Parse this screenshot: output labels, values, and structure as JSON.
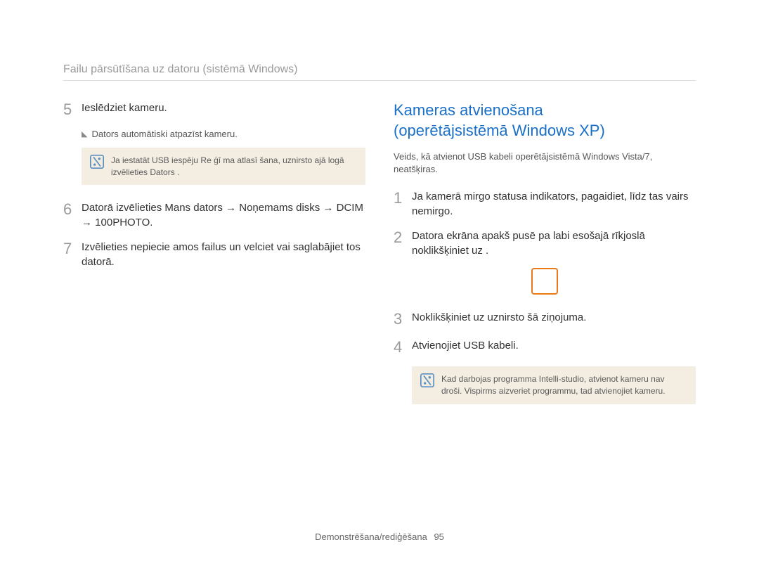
{
  "breadcrumb": "Failu pārsūtīšana uz datoru (sistēmā Windows)",
  "left": {
    "step5": {
      "num": "5",
      "text": "Ieslēdziet kameru.",
      "sub": "Dators automātiski atpazīst kameru.",
      "note": "Ja iestatāt USB iespēju Re ģī ma atlasī šana, uznirsto ajā logā izvēlieties Dators ."
    },
    "step6": {
      "num": "6",
      "text": "Datorā izvēlieties Mans dators → Noņemams disks  → DCIM → 100PHOTO."
    },
    "step7": {
      "num": "7",
      "text": "Izvēlieties nepiecie amos failus un velciet vai saglabājiet tos datorā."
    }
  },
  "right": {
    "title_line1": "Kameras atvienošana",
    "title_line2": "(operētājsistēmā Windows XP)",
    "lead": "Veids, kā atvienot USB kabeli operētājsistēmā Windows Vista/7, neatšķiras.",
    "step1": {
      "num": "1",
      "text": "Ja kamerā mirgo statusa indikators, pagaidiet, līdz tas vairs nemirgo."
    },
    "step2": {
      "num": "2",
      "text": "Datora ekrāna apakš pusē pa labi esošajā rīkjoslā noklikšķiniet uz     ."
    },
    "step3": {
      "num": "3",
      "text": "Noklikšķiniet uz uznirsto šā ziņojuma."
    },
    "step4": {
      "num": "4",
      "text": "Atvienojiet USB kabeli."
    },
    "note": "Kad darbojas programma Intelli-studio, atvienot kameru nav droši. Vispirms aizveriet programmu, tad atvienojiet kameru."
  },
  "footer": {
    "section": "Demonstrēšana/rediģēšana",
    "page": "95"
  }
}
